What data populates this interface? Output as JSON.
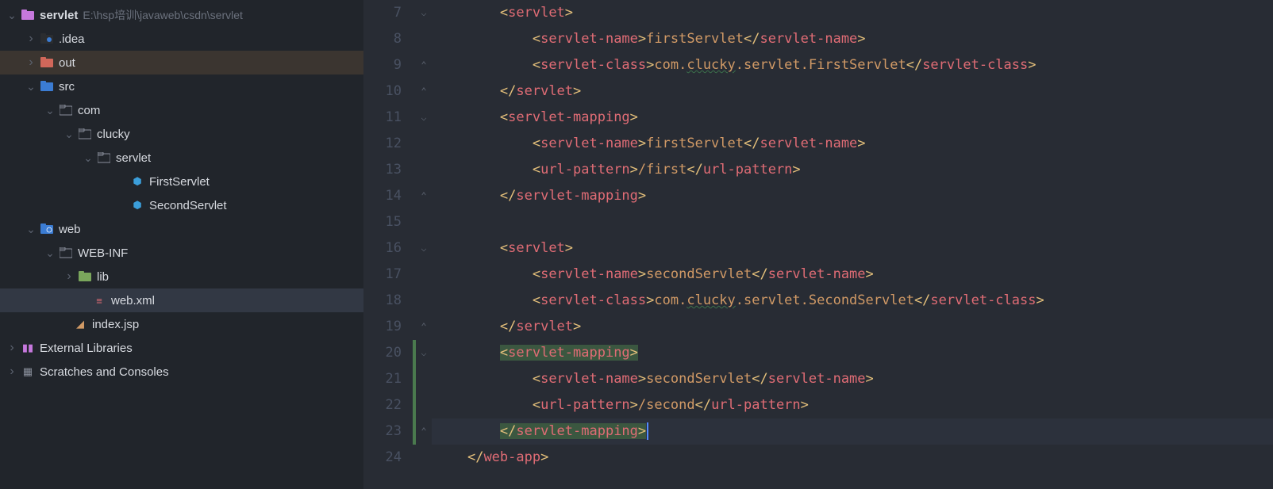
{
  "project": {
    "name": "servlet",
    "path": "E:\\hsp培训\\javaweb\\csdn\\servlet"
  },
  "tree": {
    "idea": ".idea",
    "out": "out",
    "src": "src",
    "com": "com",
    "clucky": "clucky",
    "servlet_pkg": "servlet",
    "first_servlet": "FirstServlet",
    "second_servlet": "SecondServlet",
    "web": "web",
    "webinf": "WEB-INF",
    "lib": "lib",
    "webxml": "web.xml",
    "indexjsp": "index.jsp",
    "external": "External Libraries",
    "scratches": "Scratches and Consoles"
  },
  "gutter": [
    "7",
    "8",
    "9",
    "10",
    "11",
    "12",
    "13",
    "14",
    "15",
    "16",
    "17",
    "18",
    "19",
    "20",
    "21",
    "22",
    "23",
    "24"
  ],
  "fold": [
    "⌵",
    "",
    "⌃",
    "⌃",
    "⌵",
    "",
    "",
    "⌃",
    "",
    "⌵",
    "",
    "",
    "⌃",
    "⌵",
    "",
    "",
    "⌃",
    ""
  ],
  "code": {
    "l7": {
      "indent": "        ",
      "t1": "servlet"
    },
    "l8": {
      "indent": "            ",
      "t1": "servlet-name",
      "v": "firstServlet"
    },
    "l9": {
      "indent": "            ",
      "t1": "servlet-class",
      "v": "com.clucky.servlet.FirstServlet",
      "wavy": "clucky"
    },
    "l10": {
      "indent": "        ",
      "t1": "servlet"
    },
    "l11": {
      "indent": "        ",
      "t1": "servlet-mapping"
    },
    "l12": {
      "indent": "            ",
      "t1": "servlet-name",
      "v": "firstServlet"
    },
    "l13": {
      "indent": "            ",
      "t1": "url-pattern",
      "v": "/first"
    },
    "l14": {
      "indent": "        ",
      "t1": "servlet-mapping"
    },
    "l15": "",
    "l16": {
      "indent": "        ",
      "t1": "servlet"
    },
    "l17": {
      "indent": "            ",
      "t1": "servlet-name",
      "v": "secondServlet"
    },
    "l18": {
      "indent": "            ",
      "t1": "servlet-class",
      "v": "com.clucky.servlet.SecondServlet",
      "wavy": "clucky"
    },
    "l19": {
      "indent": "        ",
      "t1": "servlet"
    },
    "l20": {
      "indent": "        ",
      "t1": "servlet-mapping"
    },
    "l21": {
      "indent": "            ",
      "t1": "servlet-name",
      "v": "secondServlet"
    },
    "l22": {
      "indent": "            ",
      "t1": "url-pattern",
      "v": "/second"
    },
    "l23": {
      "indent": "        ",
      "t1": "servlet-mapping"
    },
    "l24": {
      "indent": "    ",
      "t1": "web-app"
    }
  }
}
